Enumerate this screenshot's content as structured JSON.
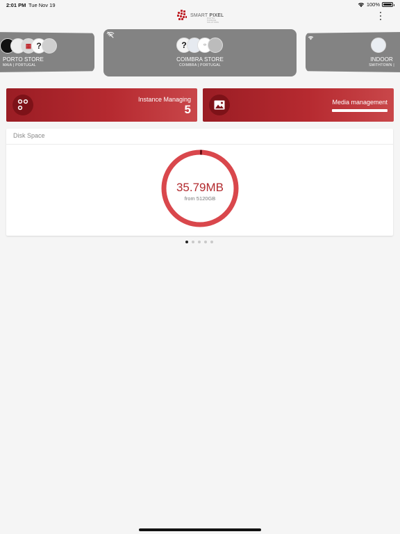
{
  "status_bar": {
    "time": "2:01 PM",
    "date": "Tue Nov 19",
    "battery_text": "100%",
    "battery_level": 1.0
  },
  "header": {
    "logo_prefix": "SMART",
    "logo_suffix": "PIXEL",
    "logo_tagline": "DIGITAL SIGNAGE SOLUTIONS"
  },
  "stores": [
    {
      "name": "PORTO STORE",
      "location": "MAIA | PORTUGAL",
      "online": true,
      "avatars": [
        "?",
        "",
        "🎁",
        "?",
        ""
      ]
    },
    {
      "name": "COIMBRA STORE",
      "location": "COIMBRA | PORTUGAL",
      "online": false,
      "avatars": [
        "?",
        "",
        "",
        ""
      ]
    },
    {
      "name": "INDOOR",
      "location": "SMITHTOWN |",
      "online": true,
      "avatars": [
        ""
      ]
    }
  ],
  "tiles": {
    "instance": {
      "label": "Instance Managing",
      "count": "5",
      "icon": "dots-icon"
    },
    "media": {
      "label": "Media management",
      "icon": "image-icon",
      "progress": 1.0
    }
  },
  "disk": {
    "title": "Disk Space",
    "value": "35.79MB",
    "from": "from 5120GB",
    "used_fraction": 0.007,
    "ring_color": "#d9474c",
    "used_color": "#6b0f13"
  },
  "pager": {
    "count": 5,
    "active": 0
  },
  "colors": {
    "accent": "#b62a30",
    "card_gray": "#838383"
  }
}
